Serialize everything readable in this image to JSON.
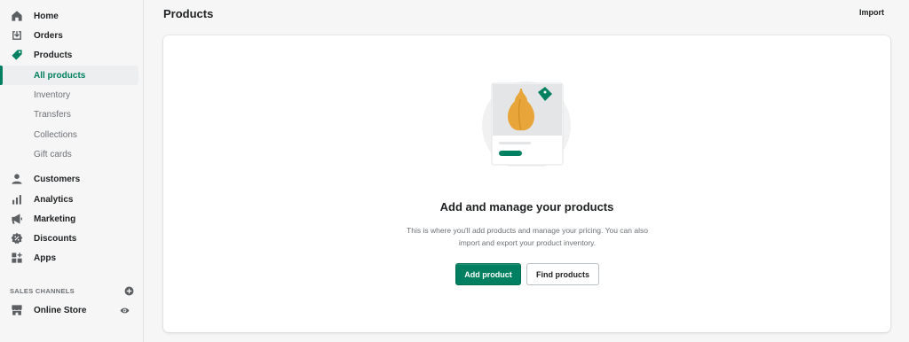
{
  "sidebar": {
    "nav": [
      {
        "label": "Home",
        "icon": "home-icon"
      },
      {
        "label": "Orders",
        "icon": "orders-icon"
      },
      {
        "label": "Products",
        "icon": "tag-icon"
      }
    ],
    "products_sub": [
      {
        "label": "All products",
        "active": true
      },
      {
        "label": "Inventory"
      },
      {
        "label": "Transfers"
      },
      {
        "label": "Collections"
      },
      {
        "label": "Gift cards"
      }
    ],
    "nav2": [
      {
        "label": "Customers",
        "icon": "person-icon"
      },
      {
        "label": "Analytics",
        "icon": "bar-chart-icon"
      },
      {
        "label": "Marketing",
        "icon": "megaphone-icon"
      },
      {
        "label": "Discounts",
        "icon": "discount-icon"
      },
      {
        "label": "Apps",
        "icon": "apps-icon"
      }
    ],
    "sales_channels": {
      "heading": "SALES CHANNELS",
      "add_icon": "plus-circle-icon",
      "items": [
        {
          "label": "Online Store",
          "icon": "store-icon",
          "action_icon": "eye-icon"
        }
      ]
    }
  },
  "header": {
    "title": "Products",
    "import_label": "Import"
  },
  "empty_state": {
    "heading": "Add and manage your products",
    "body": "This is where you'll add products and manage your pricing. You can also import and export your product inventory.",
    "primary_label": "Add product",
    "secondary_label": "Find products"
  },
  "colors": {
    "accent": "#008060",
    "text": "#202223",
    "subdued": "#6d7175",
    "background": "#f6f6f7",
    "vase": "#e7a53a"
  }
}
